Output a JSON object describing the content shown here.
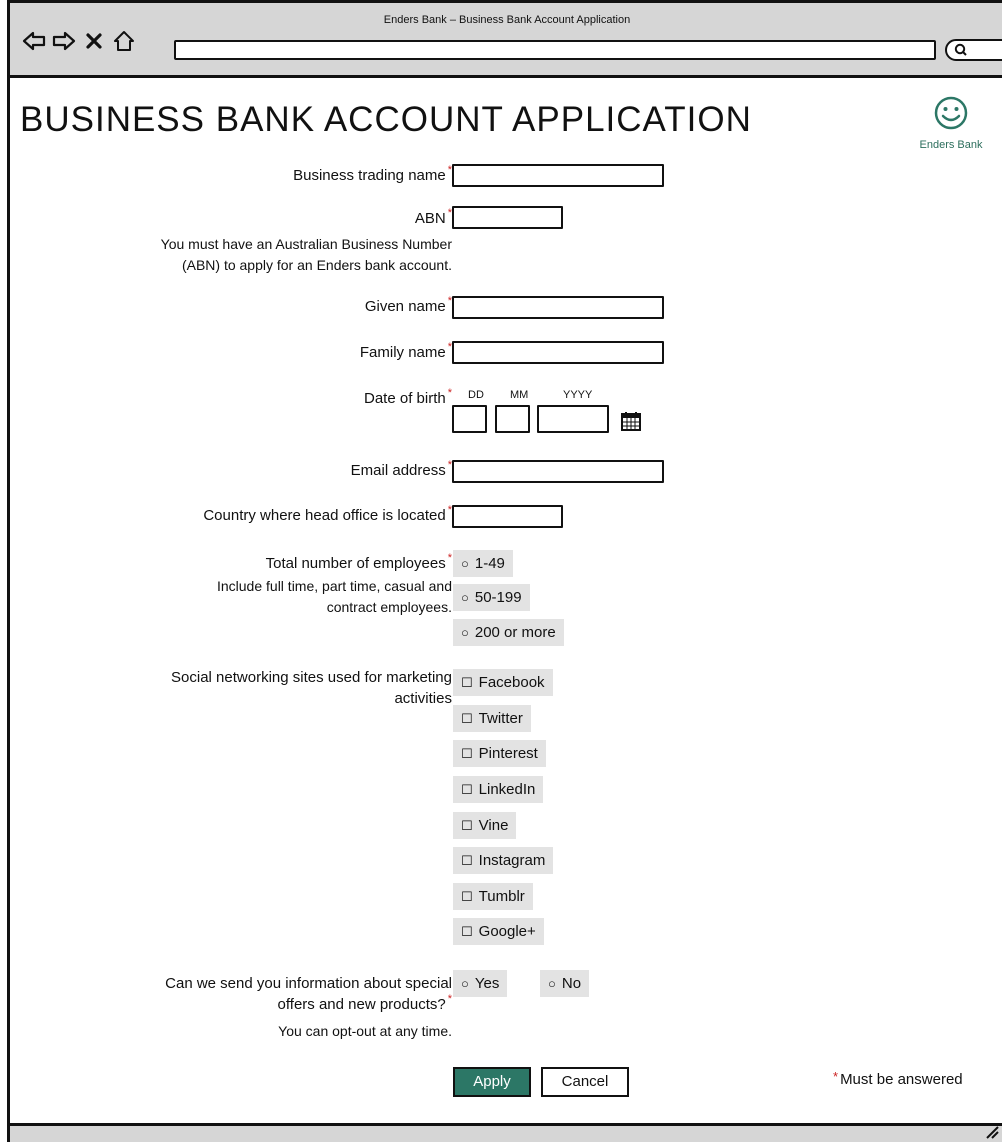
{
  "window": {
    "title": "Enders Bank – Business Bank Account Application"
  },
  "icons": {
    "back": "arrow-left-icon",
    "forward": "arrow-right-icon",
    "close": "close-icon",
    "home": "home-icon",
    "search": "search-icon",
    "calendar": "calendar-icon",
    "smiley": "smiley-icon",
    "resize": "resize-grip-icon"
  },
  "brand": {
    "name": "Enders Bank",
    "accent_color": "#2c7766"
  },
  "page": {
    "title": "BUSINESS BANK ACCOUNT APPLICATION"
  },
  "required_marker": "*",
  "form": {
    "trading_name": {
      "label": "Business trading name",
      "value": ""
    },
    "abn": {
      "label": "ABN",
      "value": "",
      "note_line1": "You must have an Australian Business Number",
      "note_line2": "(ABN) to apply for an Enders bank account."
    },
    "given_name": {
      "label": "Given name",
      "value": ""
    },
    "family_name": {
      "label": "Family name",
      "value": ""
    },
    "dob": {
      "label": "Date of birth",
      "dd": "DD",
      "mm": "MM",
      "yyyy": "YYYY"
    },
    "email": {
      "label": "Email address",
      "value": ""
    },
    "country": {
      "label": "Country where head office is located",
      "value": ""
    },
    "employees": {
      "label": "Total number of employees",
      "note_line1": "Include full time, part time, casual and",
      "note_line2": "contract employees.",
      "options": [
        "1-49",
        "50-199",
        "200 or more"
      ]
    },
    "social": {
      "label_line1": "Social networking sites used for marketing",
      "label_line2": "activities",
      "options": [
        "Facebook",
        "Twitter",
        "Pinterest",
        "LinkedIn",
        "Vine",
        "Instagram",
        "Tumblr",
        "Google+"
      ]
    },
    "offers": {
      "label_line1": "Can we send you information about special",
      "label_line2": "offers and new products?",
      "note": "You can opt-out at any time.",
      "options": [
        "Yes",
        "No"
      ]
    },
    "apply_label": "Apply",
    "cancel_label": "Cancel",
    "legend": "Must be answered"
  },
  "glyphs": {
    "radio": "○",
    "checkbox": "☐"
  }
}
